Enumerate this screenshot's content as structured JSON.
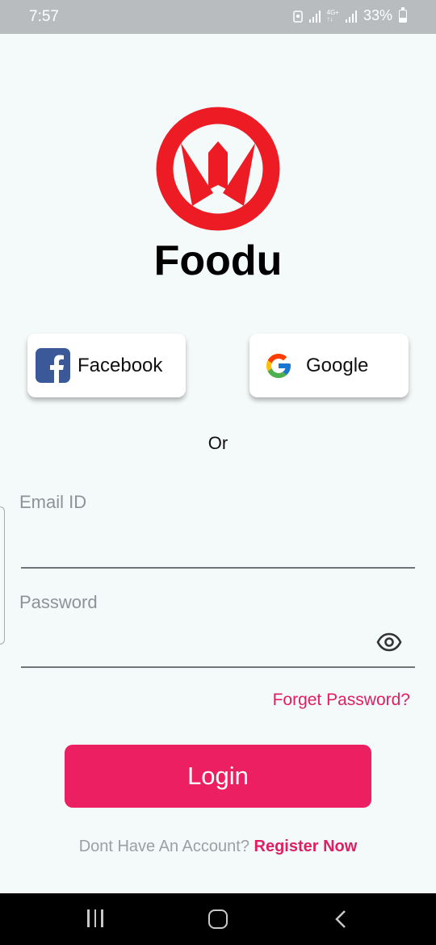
{
  "status_bar": {
    "time": "7:57",
    "network_type_top": "4G+",
    "network_type_bottom": "↑↓",
    "battery": "33%"
  },
  "app": {
    "name": "Foodu",
    "logo_icon": "overwatch-style-logo",
    "brand_color": "#ec1f62",
    "logo_color": "#ed1c24"
  },
  "social": {
    "facebook_label": "Facebook",
    "google_label": "Google"
  },
  "divider_text": "Or",
  "form": {
    "email_placeholder": "Email ID",
    "email_value": "",
    "password_placeholder": "Password",
    "password_value": "",
    "password_toggle_icon": "eye-icon",
    "forget_password": "Forget Password?"
  },
  "login_label": "Login",
  "register": {
    "prompt": "Dont Have An Account?",
    "link": "Register Now"
  },
  "nav": {
    "recent_icon": "recent-apps-icon",
    "home_icon": "home-icon",
    "back_icon": "back-icon"
  }
}
